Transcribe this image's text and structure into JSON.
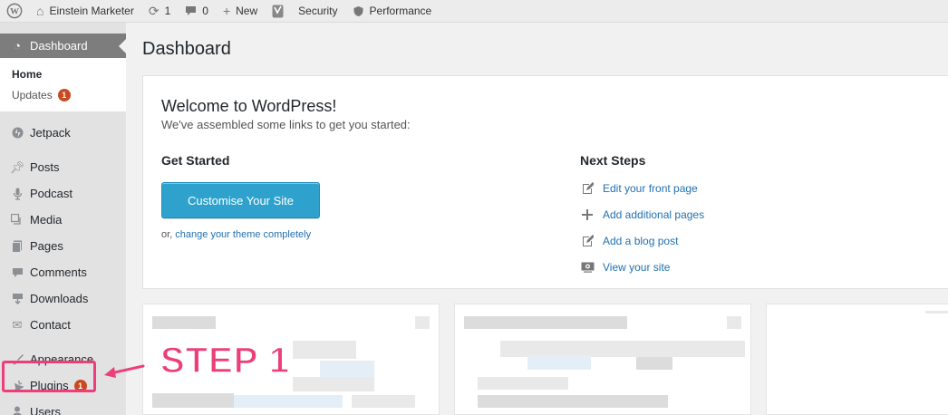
{
  "adminbar": {
    "site_name": "Einstein Marketer",
    "updates_count": "1",
    "comments_count": "0",
    "new_label": "New",
    "security_label": "Security",
    "performance_label": "Performance",
    "icons": [
      "wordpress-logo-icon",
      "home-icon",
      "updates-refresh-icon",
      "comment-bubble-icon",
      "plus-icon",
      "yoast-icon",
      "shield-icon"
    ]
  },
  "sidebar": {
    "dashboard": "Dashboard",
    "submenu": [
      {
        "label": "Home"
      },
      {
        "label": "Updates",
        "badge": "1"
      }
    ],
    "items": [
      {
        "label": "Jetpack",
        "icon": "jetpack-icon"
      },
      {
        "label": "Posts",
        "icon": "pushpin-icon"
      },
      {
        "label": "Podcast",
        "icon": "microphone-icon"
      },
      {
        "label": "Media",
        "icon": "media-icon"
      },
      {
        "label": "Pages",
        "icon": "pages-icon"
      },
      {
        "label": "Comments",
        "icon": "comments-icon"
      },
      {
        "label": "Downloads",
        "icon": "downloads-icon"
      },
      {
        "label": "Contact",
        "icon": "envelope-icon"
      },
      {
        "label": "Appearance",
        "icon": "paintbrush-icon"
      },
      {
        "label": "Plugins",
        "icon": "plugin-icon",
        "badge": "1"
      },
      {
        "label": "Users",
        "icon": "user-icon"
      }
    ]
  },
  "main": {
    "page_title": "Dashboard",
    "welcome": {
      "title": "Welcome to WordPress!",
      "subtitle": "We've assembled some links to get you started:",
      "get_started_heading": "Get Started",
      "customise_button": "Customise Your Site",
      "alt_prefix": "or,",
      "alt_link": "change your theme completely",
      "next_steps_heading": "Next Steps",
      "next_steps": [
        {
          "label": "Edit your front page",
          "icon": "edit-icon"
        },
        {
          "label": "Add additional pages",
          "icon": "plus-icon"
        },
        {
          "label": "Add a blog post",
          "icon": "edit-icon"
        },
        {
          "label": "View your site",
          "icon": "view-site-icon"
        }
      ]
    }
  },
  "annotation": {
    "step_label": "STEP 1",
    "color": "#ec3f7a"
  }
}
